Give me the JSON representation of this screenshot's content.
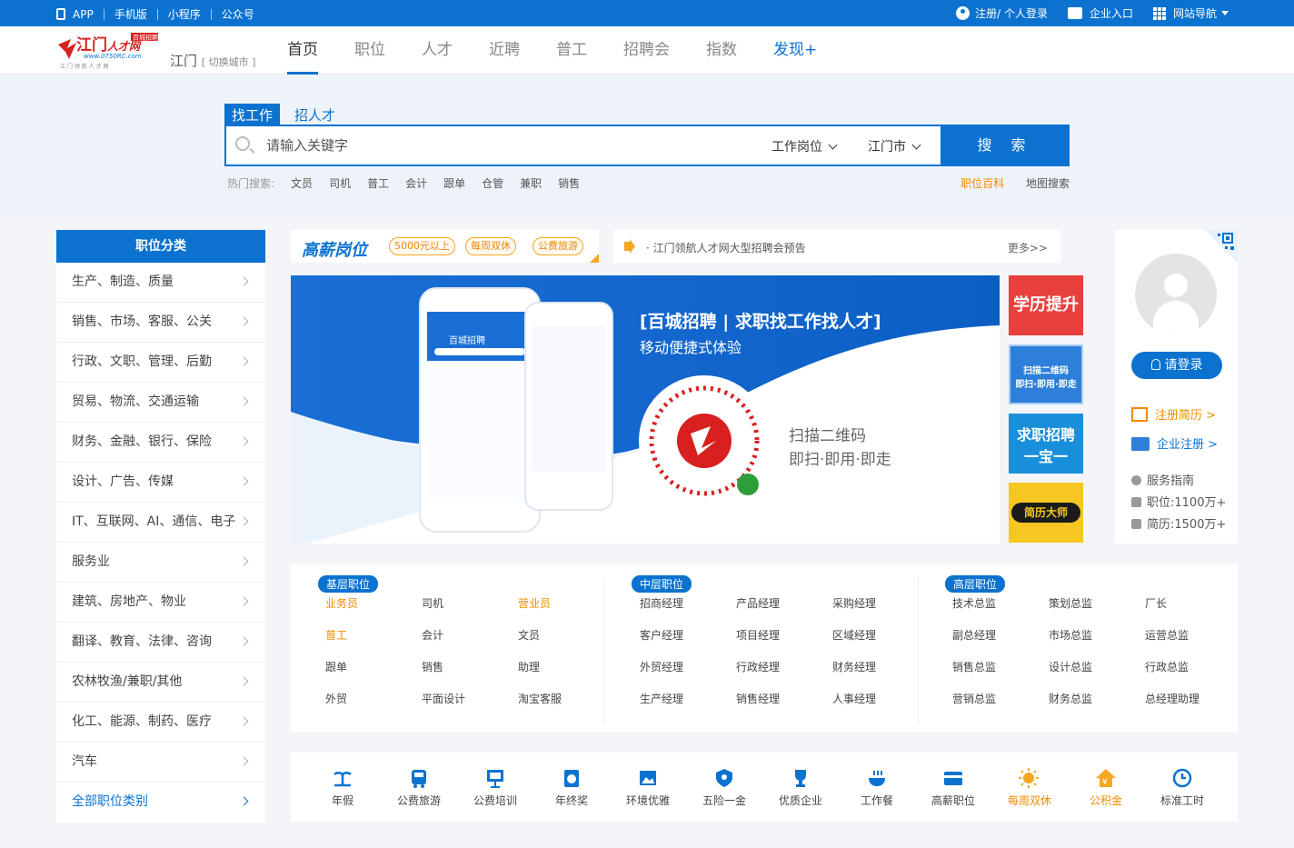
{
  "topbar": {
    "left": [
      "APP",
      "手机版",
      "小程序",
      "公众号"
    ],
    "register_login": "注册/ 个人登录",
    "enterprise": "企业入口",
    "site_nav": "网站导航"
  },
  "header": {
    "logo_text": "江门人才网",
    "logo_url": "www.0750RC.com",
    "logo_badge": "百城招聘",
    "city": "江门",
    "switch_city": "[ 切换城市 ]",
    "nav": [
      "首页",
      "职位",
      "人才",
      "近聘",
      "普工",
      "招聘会",
      "指数",
      "发现+"
    ]
  },
  "search": {
    "tabs": [
      "找工作",
      "招人才"
    ],
    "placeholder": "请输入关键字",
    "position_select": "工作岗位",
    "city_select": "江门市",
    "button": "搜 索",
    "hot_label": "热门搜索:",
    "hot_words": [
      "文员",
      "司机",
      "普工",
      "会计",
      "跟单",
      "仓管",
      "兼职",
      "销售"
    ],
    "job_wiki": "职位百科",
    "map_search": "地图搜索"
  },
  "category": {
    "title": "职位分类",
    "items": [
      "生产、制造、质量",
      "销售、市场、客服、公关",
      "行政、文职、管理、后勤",
      "贸易、物流、交通运输",
      "财务、金融、银行、保险",
      "设计、广告、传媒",
      "IT、互联网、AI、通信、电子",
      "服务业",
      "建筑、房地产、物业",
      "翻译、教育、法律、咨询",
      "农林牧渔/兼职/其他",
      "化工、能源、制药、医疗",
      "汽车"
    ],
    "all": "全部职位类别"
  },
  "gaoxin": {
    "logo": "高薪岗位",
    "tags": [
      "5000元以上",
      "每周双休",
      "公费旅游"
    ]
  },
  "notice": {
    "text": "· 江门领航人才网大型招聘会预告",
    "more": "更多>>"
  },
  "banner": {
    "headline": "[百城招聘 | 求职找工作找人才]",
    "subline": "移动便捷式体验",
    "scan1": "扫描二维码",
    "scan2": "即扫·即用·即走",
    "phone_brand": "百城招聘"
  },
  "side_tiles": {
    "t1": "学历提升",
    "t2a": "扫描二维码",
    "t2b": "即扫·即用·即走",
    "t3a": "求职招聘",
    "t3b": "一宝一",
    "t4": "简历大师"
  },
  "profile": {
    "login": "请登录",
    "register_resume": "注册简历 >",
    "company_register": "企业注册 >",
    "service_guide": "服务指南",
    "jobs_count": "职位:1100万+",
    "resumes_count": "简历:1500万+"
  },
  "levels": {
    "basic": {
      "title": "基层职位",
      "items": [
        "业务员",
        "司机",
        "营业员",
        "普工",
        "会计",
        "文员",
        "跟单",
        "销售",
        "助理",
        "外贸",
        "平面设计",
        "淘宝客服"
      ],
      "highlight": [
        0,
        2,
        3
      ]
    },
    "middle": {
      "title": "中层职位",
      "items": [
        "招商经理",
        "产品经理",
        "采购经理",
        "客户经理",
        "项目经理",
        "区域经理",
        "外贸经理",
        "行政经理",
        "财务经理",
        "生产经理",
        "销售经理",
        "人事经理"
      ]
    },
    "senior": {
      "title": "高层职位",
      "items": [
        "技术总监",
        "策划总监",
        "厂长",
        "副总经理",
        "市场总监",
        "运营总监",
        "销售总监",
        "设计总监",
        "行政总监",
        "营销总监",
        "财务总监",
        "总经理助理"
      ]
    }
  },
  "benefits": [
    {
      "label": "年假",
      "icon": "beach-icon"
    },
    {
      "label": "公费旅游",
      "icon": "bus-icon"
    },
    {
      "label": "公费培训",
      "icon": "training-icon"
    },
    {
      "label": "年终奖",
      "icon": "bonus-icon"
    },
    {
      "label": "环境优雅",
      "icon": "picture-icon"
    },
    {
      "label": "五险一金",
      "icon": "shield-icon"
    },
    {
      "label": "优质企业",
      "icon": "trophy-icon"
    },
    {
      "label": "工作餐",
      "icon": "meal-icon"
    },
    {
      "label": "高薪职位",
      "icon": "card-icon"
    },
    {
      "label": "每周双休",
      "icon": "sun-icon"
    },
    {
      "label": "公积金",
      "icon": "house-icon"
    },
    {
      "label": "标准工时",
      "icon": "clock-icon"
    }
  ],
  "colors": {
    "primary": "#0b72d0",
    "accent": "#f08b00"
  }
}
